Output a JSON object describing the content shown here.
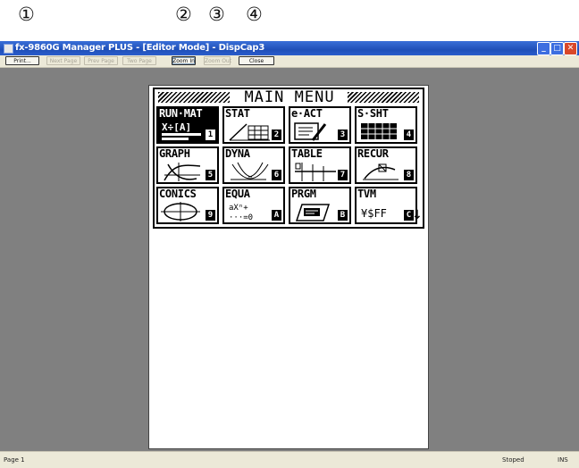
{
  "callouts": [
    "①",
    "②",
    "③",
    "④"
  ],
  "window": {
    "title": "fx-9860G Manager PLUS - [Editor Mode] - DispCap3",
    "minimize": "_",
    "maximize": "□",
    "close": "✕"
  },
  "toolbar": {
    "print": "Print...",
    "next_page": "Next Page",
    "prev_page": "Prev Page",
    "two_page": "Two Page",
    "zoom_in": "Zoom In",
    "zoom_out": "Zoom Out",
    "close": "Close"
  },
  "calculator": {
    "title": "MAIN MENU",
    "icons": [
      {
        "label": "RUN·MAT",
        "key": "1",
        "selected": true,
        "icon": "run-mat-icon"
      },
      {
        "label": "STAT",
        "key": "2",
        "selected": false,
        "icon": "stat-icon"
      },
      {
        "label": "e·ACT",
        "key": "3",
        "selected": false,
        "icon": "e-act-icon"
      },
      {
        "label": "S·SHT",
        "key": "4",
        "selected": false,
        "icon": "spreadsheet-icon"
      },
      {
        "label": "GRAPH",
        "key": "5",
        "selected": false,
        "icon": "graph-icon"
      },
      {
        "label": "DYNA",
        "key": "6",
        "selected": false,
        "icon": "dyna-icon"
      },
      {
        "label": "TABLE",
        "key": "7",
        "selected": false,
        "icon": "table-icon"
      },
      {
        "label": "RECUR",
        "key": "8",
        "selected": false,
        "icon": "recur-icon"
      },
      {
        "label": "CONICS",
        "key": "9",
        "selected": false,
        "icon": "conics-icon"
      },
      {
        "label": "EQUA",
        "key": "A",
        "selected": false,
        "icon": "equa-icon"
      },
      {
        "label": "PRGM",
        "key": "B",
        "selected": false,
        "icon": "prgm-icon"
      },
      {
        "label": "TVM",
        "key": "C",
        "selected": false,
        "icon": "tvm-icon"
      }
    ],
    "icon_glyphs": {
      "run_mat": "X÷[A]",
      "equa": "aXⁿ+\n···=0",
      "tvm": "¥$FF"
    },
    "scroll_arrow": "↓"
  },
  "status": {
    "page": "Page 1",
    "state": "Stoped",
    "mode": "INS"
  }
}
